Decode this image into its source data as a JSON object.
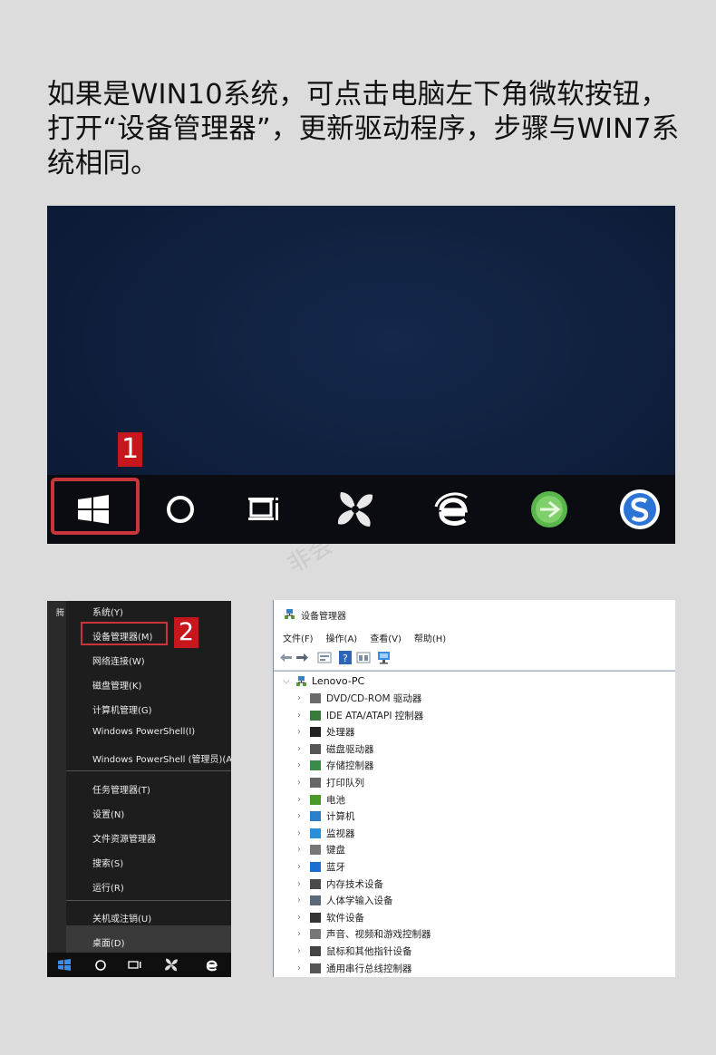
{
  "heading": "如果是WIN10系统，可点击电脑左下角微软按钮，打开“设备管理器”，更新驱动程序，步骤与WIN7系统相同。",
  "watermark": "非会",
  "step1": "1",
  "step2": "2",
  "power_menu": {
    "side_label": "腾",
    "group1": [
      "系统(Y)",
      "设备管理器(M)",
      "网络连接(W)",
      "磁盘管理(K)",
      "计算机管理(G)",
      "Windows PowerShell(I)",
      "Windows PowerShell (管理员)(A)"
    ],
    "group2": [
      "任务管理器(T)",
      "设置(N)",
      "文件资源管理器",
      "搜索(S)",
      "运行(R)"
    ],
    "group3": [
      "关机或注销(U)",
      "桌面(D)"
    ]
  },
  "device_manager": {
    "title": "设备管理器",
    "menu": [
      "文件(F)",
      "操作(A)",
      "查看(V)",
      "帮助(H)"
    ],
    "root": "Lenovo-PC",
    "items": [
      {
        "label": "DVD/CD-ROM 驱动器",
        "icon": "dvd-drive-icon",
        "color": "#6b6b6b"
      },
      {
        "label": "IDE ATA/ATAPI 控制器",
        "icon": "ide-controller-icon",
        "color": "#3a7a3a"
      },
      {
        "label": "处理器",
        "icon": "processor-icon",
        "color": "#222222"
      },
      {
        "label": "磁盘驱动器",
        "icon": "disk-drive-icon",
        "color": "#555555"
      },
      {
        "label": "存储控制器",
        "icon": "storage-controller-icon",
        "color": "#3a8a4a"
      },
      {
        "label": "打印队列",
        "icon": "printer-icon",
        "color": "#666666"
      },
      {
        "label": "电池",
        "icon": "battery-icon",
        "color": "#4a9a2a"
      },
      {
        "label": "计算机",
        "icon": "computer-icon",
        "color": "#2a7fc9"
      },
      {
        "label": "监视器",
        "icon": "monitor-icon",
        "color": "#2a8fd9"
      },
      {
        "label": "键盘",
        "icon": "keyboard-icon",
        "color": "#777777"
      },
      {
        "label": "蓝牙",
        "icon": "bluetooth-icon",
        "color": "#1a6fd0"
      },
      {
        "label": "内存技术设备",
        "icon": "memory-device-icon",
        "color": "#4a4a4a"
      },
      {
        "label": "人体学输入设备",
        "icon": "hid-icon",
        "color": "#5a6a7a"
      },
      {
        "label": "软件设备",
        "icon": "software-device-icon",
        "color": "#333333"
      },
      {
        "label": "声音、视频和游戏控制器",
        "icon": "sound-icon",
        "color": "#777777"
      },
      {
        "label": "鼠标和其他指针设备",
        "icon": "mouse-icon",
        "color": "#444444"
      },
      {
        "label": "通用串行总线控制器",
        "icon": "usb-icon",
        "color": "#555555"
      }
    ]
  },
  "colors": {
    "highlight_box": "#c9353b",
    "badge": "#c8161d"
  }
}
